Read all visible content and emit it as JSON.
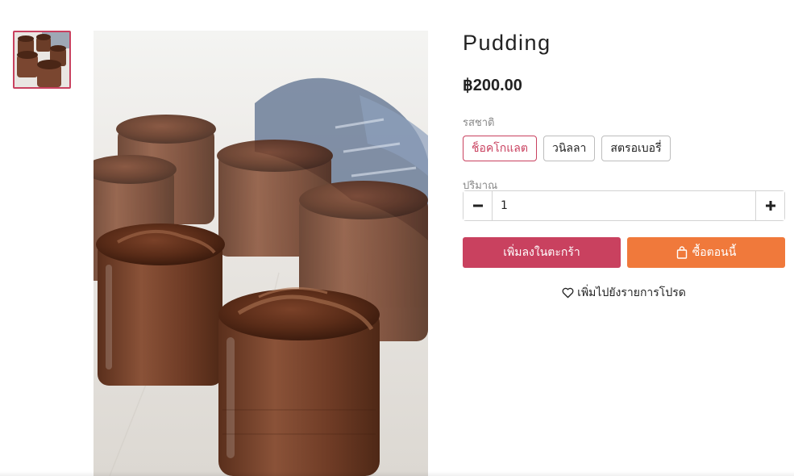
{
  "product": {
    "title": "Pudding",
    "price": "฿200.00",
    "image_alt": "chocolate pudding jars"
  },
  "options": {
    "flavor_label": "รสชาติ",
    "flavors": [
      "ช็อคโกแลต",
      "วนิลลา",
      "สตรอเบอรี่"
    ],
    "selected_flavor": "ช็อคโกแลต",
    "quantity_label": "ปริมาณ",
    "quantity_value": "1"
  },
  "actions": {
    "add_to_cart": "เพิ่มลงในตะกร้า",
    "buy_now": "ซื้อตอนนี้",
    "wishlist": "เพิ่มไปยังรายการโปรด"
  },
  "icons": {
    "minus": "minus-icon",
    "plus": "plus-icon",
    "bag": "shopping-bag-icon",
    "heart": "heart-icon"
  },
  "colors": {
    "accent": "#c9415f",
    "buy_now": "#f0793b"
  }
}
